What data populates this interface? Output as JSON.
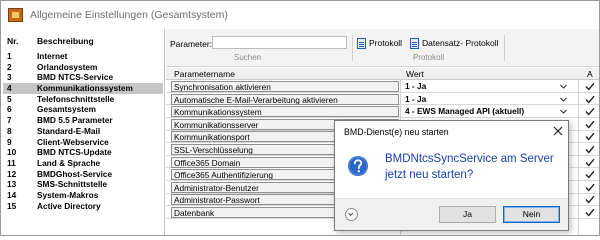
{
  "window": {
    "title": "Allgemeine Einstellungen (Gesamtsystem)"
  },
  "left": {
    "header": {
      "nr": "Nr.",
      "desc": "Beschreibung"
    },
    "items": [
      {
        "nr": "1",
        "label": "Internet"
      },
      {
        "nr": "2",
        "label": "Orlandosystem"
      },
      {
        "nr": "3",
        "label": "BMD NTCS-Service"
      },
      {
        "nr": "4",
        "label": "Kommunikationssystem",
        "selected": true
      },
      {
        "nr": "5",
        "label": "Telefonschnittstelle"
      },
      {
        "nr": "6",
        "label": "Gesamtsystem"
      },
      {
        "nr": "7",
        "label": "BMD 5.5 Parameter"
      },
      {
        "nr": "8",
        "label": "Standard-E-Mail"
      },
      {
        "nr": "9",
        "label": "Client-Webservice"
      },
      {
        "nr": "10",
        "label": "BMD NTCS-Update"
      },
      {
        "nr": "11",
        "label": "Land & Sprache"
      },
      {
        "nr": "12",
        "label": "BMDGhost-Service"
      },
      {
        "nr": "13",
        "label": "SMS-Schnittstelle"
      },
      {
        "nr": "14",
        "label": "System-Makros"
      },
      {
        "nr": "15",
        "label": "Active Directory"
      }
    ]
  },
  "toolbar": {
    "param_label": "Parameter:",
    "param_value": "",
    "protokoll_label": "Protokoll",
    "datensatz_label": "Datensatz- Protokoll",
    "group_suchen": "Suchen",
    "group_protokoll": "Protokoll"
  },
  "grid": {
    "col_name": "Parametername",
    "col_value": "Wert",
    "col_a": "A",
    "rows": [
      {
        "name": "Synchronisation aktivieren",
        "value": "1 - Ja",
        "dropdown": true,
        "checked": true
      },
      {
        "name": "Automatische E-Mail-Verarbeitung aktivieren",
        "value": "1 - Ja",
        "dropdown": true,
        "checked": true
      },
      {
        "name": "Kommunikationssystem",
        "value": "4 - EWS Managed API (aktuell)",
        "dropdown": true,
        "checked": true
      },
      {
        "name": "Kommunikationsserver",
        "value": "",
        "dropdown": false,
        "checked": true
      },
      {
        "name": "Kommunikationsport",
        "value": "",
        "dropdown": false,
        "checked": true
      },
      {
        "name": "SSL-Verschlüsselung",
        "value": "",
        "dropdown": false,
        "checked": true
      },
      {
        "name": "Office365 Domain",
        "value": "",
        "dropdown": false,
        "checked": true
      },
      {
        "name": "Office365 Authentifizierung",
        "value": "",
        "dropdown": false,
        "checked": true
      },
      {
        "name": "Administrator-Benutzer",
        "value": "",
        "dropdown": false,
        "checked": true
      },
      {
        "name": "Administrator-Passwort",
        "value": "",
        "dropdown": false,
        "checked": true
      },
      {
        "name": "Datenbank",
        "value": "",
        "dropdown": false,
        "checked": true
      }
    ]
  },
  "dialog": {
    "title": "BMD-Dienst(e) neu starten",
    "message_line1": "BMDNtcsSyncService am Server",
    "message_line2": "jetzt neu starten?",
    "yes_label": "Ja",
    "no_label": "Nein",
    "icon": "question-icon"
  },
  "colors": {
    "selection": "#c6c6c6",
    "dialog_text": "#1a3fae",
    "default_button_border": "#0a64c8"
  }
}
